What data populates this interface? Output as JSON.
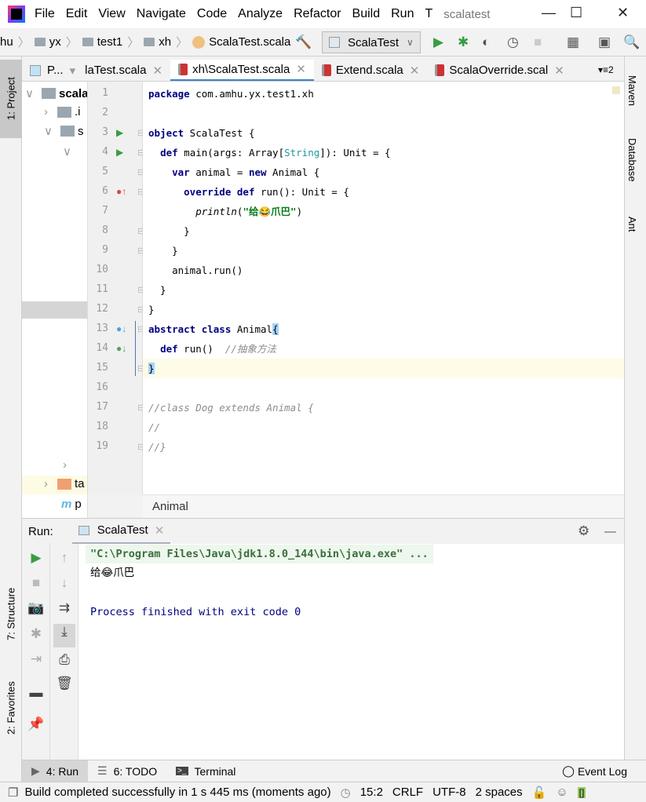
{
  "titlebar": {
    "menus": [
      "File",
      "Edit",
      "View",
      "Navigate",
      "Code",
      "Analyze",
      "Refactor",
      "Build",
      "Run",
      "T"
    ],
    "project_name": "scalatest"
  },
  "navbar": {
    "crumbs": [
      "hu",
      "yx",
      "test1",
      "xh",
      "ScalaTest.scala"
    ],
    "run_config": "ScalaTest"
  },
  "tabs": [
    {
      "label": "P...",
      "kind": "project"
    },
    {
      "label": "laTest.scala"
    },
    {
      "label": "xh\\ScalaTest.scala",
      "active": true
    },
    {
      "label": "Extend.scala"
    },
    {
      "label": "ScalaOverride.scal"
    }
  ],
  "tabs_overflow": "2",
  "left_strip": {
    "project": "1: Project",
    "structure": "7: Structure",
    "favorites": "2: Favorites"
  },
  "right_strip": [
    "Maven",
    "Database",
    "Ant"
  ],
  "project_tree": [
    {
      "label": "scala",
      "bold": true
    },
    {
      "label": ".i"
    },
    {
      "label": "s"
    },
    {
      "label": "ta"
    },
    {
      "label": "p"
    }
  ],
  "code_lines": [
    [
      {
        "t": "package",
        "k": "kw"
      },
      {
        "t": " com.amhu.yx.test1.xh"
      }
    ],
    [],
    [
      {
        "t": "object",
        "k": "kw"
      },
      {
        "t": " ScalaTest {"
      }
    ],
    [
      {
        "t": "  "
      },
      {
        "t": "def",
        "k": "kw"
      },
      {
        "t": " main(args: Array["
      },
      {
        "t": "String",
        "k": "ty"
      },
      {
        "t": "]): Unit = {"
      }
    ],
    [
      {
        "t": "    "
      },
      {
        "t": "var",
        "k": "kw"
      },
      {
        "t": " animal = "
      },
      {
        "t": "new",
        "k": "kw"
      },
      {
        "t": " Animal {"
      }
    ],
    [
      {
        "t": "      "
      },
      {
        "t": "override def",
        "k": "kw"
      },
      {
        "t": " run(): Unit = {"
      }
    ],
    [
      {
        "t": "        "
      },
      {
        "t": "println",
        "k": "fn"
      },
      {
        "t": "("
      },
      {
        "t": "\"给😂爪巴\"",
        "k": "str"
      },
      {
        "t": ")"
      }
    ],
    [
      {
        "t": "      }"
      }
    ],
    [
      {
        "t": "    }"
      }
    ],
    [
      {
        "t": "    animal.run()"
      }
    ],
    [
      {
        "t": "  }"
      }
    ],
    [
      {
        "t": "}"
      }
    ],
    [
      {
        "t": "abstract class",
        "k": "kw"
      },
      {
        "t": " Animal"
      },
      {
        "t": "{",
        "k": "hl"
      }
    ],
    [
      {
        "t": "  "
      },
      {
        "t": "def",
        "k": "kw"
      },
      {
        "t": " run()  "
      },
      {
        "t": "//抽象方法",
        "k": "cm"
      }
    ],
    [
      {
        "t": "}",
        "k": "hl"
      }
    ],
    [],
    [
      {
        "t": "//class Dog extends Animal {",
        "k": "cm"
      }
    ],
    [
      {
        "t": "//",
        "k": "cm"
      }
    ],
    [
      {
        "t": "//}",
        "k": "cm"
      }
    ]
  ],
  "cursor_line": 15,
  "editor_breadcrumb": "Animal",
  "run_panel": {
    "label": "Run:",
    "tab": "ScalaTest",
    "console": [
      "\"C:\\Program Files\\Java\\jdk1.8.0_144\\bin\\java.exe\" ...",
      "给😂爪巴",
      "",
      "Process finished with exit code 0"
    ]
  },
  "bottom_tabs": {
    "run": "4: Run",
    "todo": "6: TODO",
    "terminal": "Terminal",
    "event_log": "Event Log"
  },
  "status": {
    "message": "Build completed successfully in 1 s 445 ms (moments ago)",
    "position": "15:2",
    "line_sep": "CRLF",
    "encoding": "UTF-8",
    "indent": "2 spaces"
  }
}
